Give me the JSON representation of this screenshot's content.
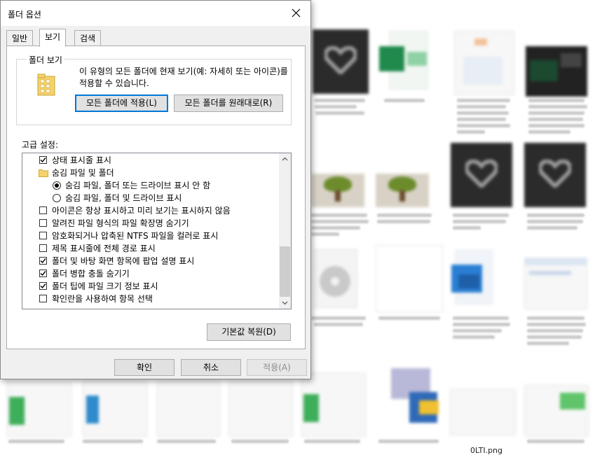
{
  "dialog": {
    "title": "폴더 옵션",
    "tabs": [
      {
        "label": "일반"
      },
      {
        "label": "보기"
      },
      {
        "label": "검색"
      }
    ],
    "folder_view": {
      "group_label": "폴더 보기",
      "description": "이 유형의 모든 폴더에 현재 보기(예: 자세히 또는 아이콘)를 적용할 수 있습니다.",
      "apply_button": "모든 폴더에 적용(L)",
      "reset_button": "모든 폴더를 원래대로(R)"
    },
    "advanced": {
      "label": "고급 설정:",
      "items": [
        {
          "type": "checkbox",
          "checked": true,
          "label": "상태 표시줄 표시"
        },
        {
          "type": "folder",
          "label": "숨김 파일 및 폴더"
        },
        {
          "type": "radio",
          "checked": true,
          "label": "숨김 파일, 폴더 또는 드라이브 표시 안 함"
        },
        {
          "type": "radio",
          "checked": false,
          "label": "숨김 파일, 폴더 및 드라이브 표시"
        },
        {
          "type": "checkbox",
          "checked": false,
          "label": "아이콘은 항상 표시하고 미리 보기는 표시하지 않음"
        },
        {
          "type": "checkbox",
          "checked": false,
          "label": "알려진 파일 형식의 파일 확장명 숨기기"
        },
        {
          "type": "checkbox",
          "checked": false,
          "label": "암호화되거나 압축된 NTFS 파일을 컬러로 표시"
        },
        {
          "type": "checkbox",
          "checked": false,
          "label": "제목 표시줄에 전체 경로 표시"
        },
        {
          "type": "checkbox",
          "checked": true,
          "label": "폴더 및 바탕 화면 항목에 팝업 설명 표시"
        },
        {
          "type": "checkbox",
          "checked": true,
          "label": "폴더 병합 충돌 숨기기"
        },
        {
          "type": "checkbox",
          "checked": true,
          "label": "폴더 팁에 파일 크기 정보 표시"
        },
        {
          "type": "checkbox",
          "checked": false,
          "label": "확인란을 사용하여 항목 선택"
        }
      ],
      "restore_defaults": "기본값 복원(D)"
    },
    "footer": {
      "ok": "확인",
      "cancel": "취소",
      "apply": "적용(A)"
    }
  },
  "background": {
    "partial_filename": "0LTI.png"
  },
  "colors": {
    "accent": "#0078d7",
    "dialog_bg": "#f0f0f0",
    "folder_yellow": "#f5d36b"
  }
}
